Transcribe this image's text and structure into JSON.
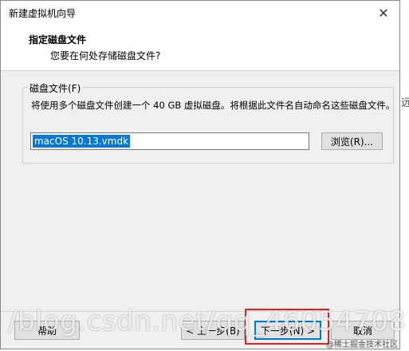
{
  "window": {
    "title": "新建虚拟机向导",
    "close_glyph": "✕"
  },
  "header": {
    "title": "指定磁盘文件",
    "subtitle": "您要在何处存储磁盘文件?"
  },
  "disk_group": {
    "legend": "磁盘文件(F)",
    "description": "将使用多个磁盘文件创建一个 40 GB 虚拟磁盘。将根据此文件名自动命名这些磁盘文件。",
    "file_value": "macOS 10.13.vmdk",
    "browse_label": "浏览(R)..."
  },
  "buttons": {
    "help": "帮助",
    "back": "< 上一步(B)",
    "next": "下一步(N) >",
    "cancel": "取消"
  },
  "side_fragment": "远",
  "watermark": "/blog.csdn.net/qq_46054708",
  "credit": "@稀土掘金技术社区",
  "colors": {
    "selection": "#0078d7",
    "highlight_box": "#e02020"
  }
}
